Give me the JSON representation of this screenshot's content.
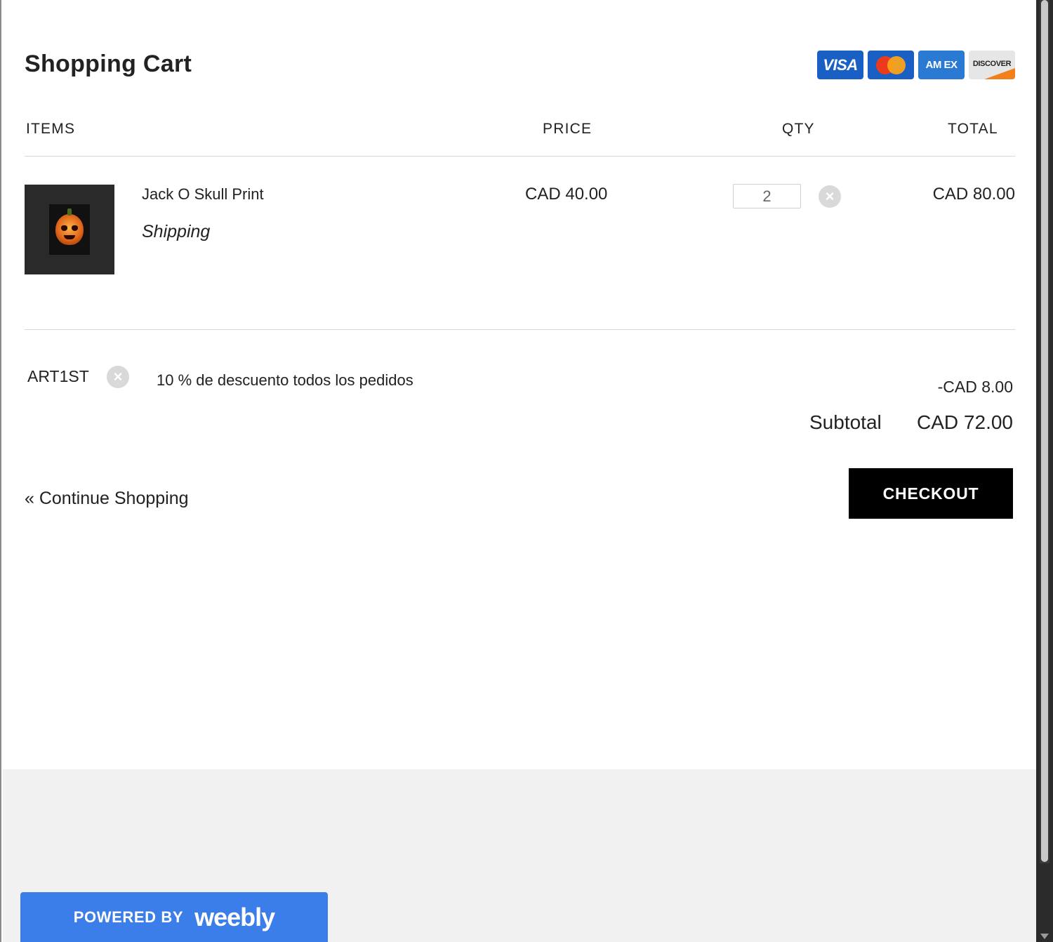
{
  "cart": {
    "title": "Shopping Cart",
    "payment_cards": [
      {
        "label": "VISA",
        "color": "#1a5fc4"
      },
      {
        "label": "",
        "color": "#1a5fc4"
      },
      {
        "label": "AM EX",
        "color": "#2a7ad4"
      },
      {
        "label": "DISCOVER",
        "color": "#e6e6e6"
      }
    ]
  },
  "columns": {
    "items": "ITEMS",
    "price": "PRICE",
    "qty": "QTY",
    "total": "TOTAL"
  },
  "line_items": [
    {
      "name": "Jack O Skull Print",
      "shipping": "Shipping",
      "price": "CAD 40.00",
      "qty": "2",
      "total": "CAD 80.00"
    }
  ],
  "coupon": {
    "code": "ART1ST",
    "description": "10 % de descuento todos los pedidos",
    "discount": "-CAD 8.00"
  },
  "summary": {
    "subtotal_label": "Subtotal",
    "subtotal_value": "CAD 72.00"
  },
  "actions": {
    "continue_label": "« Continue Shopping",
    "checkout_label": "CHECKOUT"
  },
  "footer": {
    "powered_by": "POWERED BY",
    "brand": "weebly",
    "brand_color": "#3b7de9"
  }
}
